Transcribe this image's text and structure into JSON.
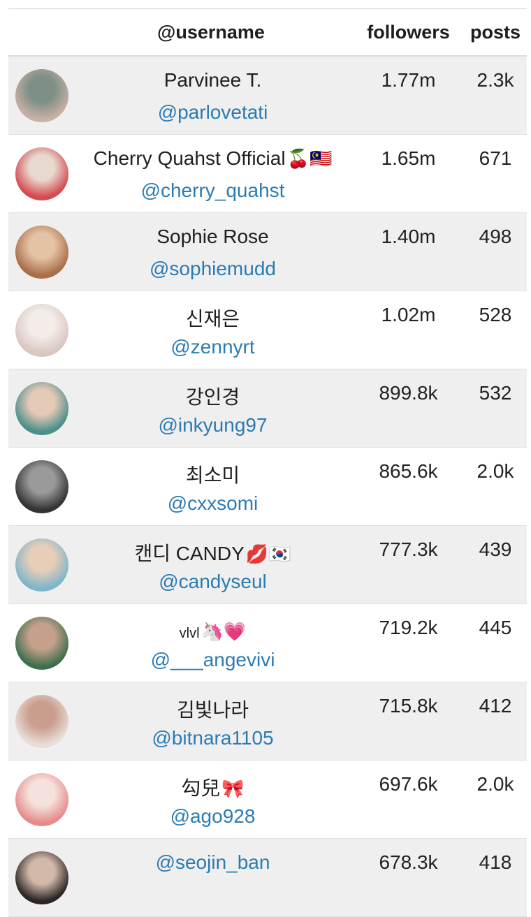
{
  "header": {
    "username": "@username",
    "followers": "followers",
    "posts": "posts"
  },
  "rows": [
    {
      "name": "Parvinee T.",
      "emoji": "",
      "handle": "@parlovetati",
      "followers": "1.77m",
      "posts": "2.3k",
      "avatar_colors": [
        "#c7b0a4",
        "#7d8f86"
      ]
    },
    {
      "name": "Cherry Quahst Official",
      "emoji": "🍒🇲🇾",
      "handle": "@cherry_quahst",
      "followers": "1.65m",
      "posts": "671",
      "avatar_colors": [
        "#d44a4f",
        "#e7d8d0"
      ]
    },
    {
      "name": "Sophie Rose",
      "emoji": "",
      "handle": "@sophiemudd",
      "followers": "1.40m",
      "posts": "498",
      "avatar_colors": [
        "#a96d48",
        "#e3c2a5"
      ]
    },
    {
      "name": "신재은",
      "emoji": "",
      "handle": "@zennyrt",
      "followers": "1.02m",
      "posts": "528",
      "avatar_colors": [
        "#d9c6bf",
        "#f3ece8"
      ]
    },
    {
      "name": "강인경",
      "emoji": "",
      "handle": "@inkyung97",
      "followers": "899.8k",
      "posts": "532",
      "avatar_colors": [
        "#4a8f8a",
        "#e7c9b8"
      ]
    },
    {
      "name": "최소미",
      "emoji": "",
      "handle": "@cxxsomi",
      "followers": "865.6k",
      "posts": "2.0k",
      "avatar_colors": [
        "#333333",
        "#9a9a9a"
      ]
    },
    {
      "name": "캔디 CANDY",
      "emoji": "💋🇰🇷",
      "handle": "@candyseul",
      "followers": "777.3k",
      "posts": "439",
      "avatar_colors": [
        "#7fb5c9",
        "#e8cdb9"
      ]
    },
    {
      "name": "vlvl",
      "emoji": "🦄💗",
      "handle": "@___angevivi",
      "followers": "719.2k",
      "posts": "445",
      "avatar_colors": [
        "#3e6f4c",
        "#c6a08b"
      ]
    },
    {
      "name": "김빛나라",
      "emoji": "",
      "handle": "@bitnara1105",
      "followers": "715.8k",
      "posts": "412",
      "avatar_colors": [
        "#e9ddd8",
        "#c99e8d"
      ]
    },
    {
      "name": "勾兒",
      "emoji": "🎀",
      "handle": "@ago928",
      "followers": "697.6k",
      "posts": "2.0k",
      "avatar_colors": [
        "#e48c8c",
        "#f6e2dc"
      ]
    },
    {
      "name": "",
      "emoji": "",
      "handle": "@seojin_ban",
      "followers": "678.3k",
      "posts": "418",
      "avatar_colors": [
        "#2b2424",
        "#d2b8a9"
      ]
    }
  ]
}
